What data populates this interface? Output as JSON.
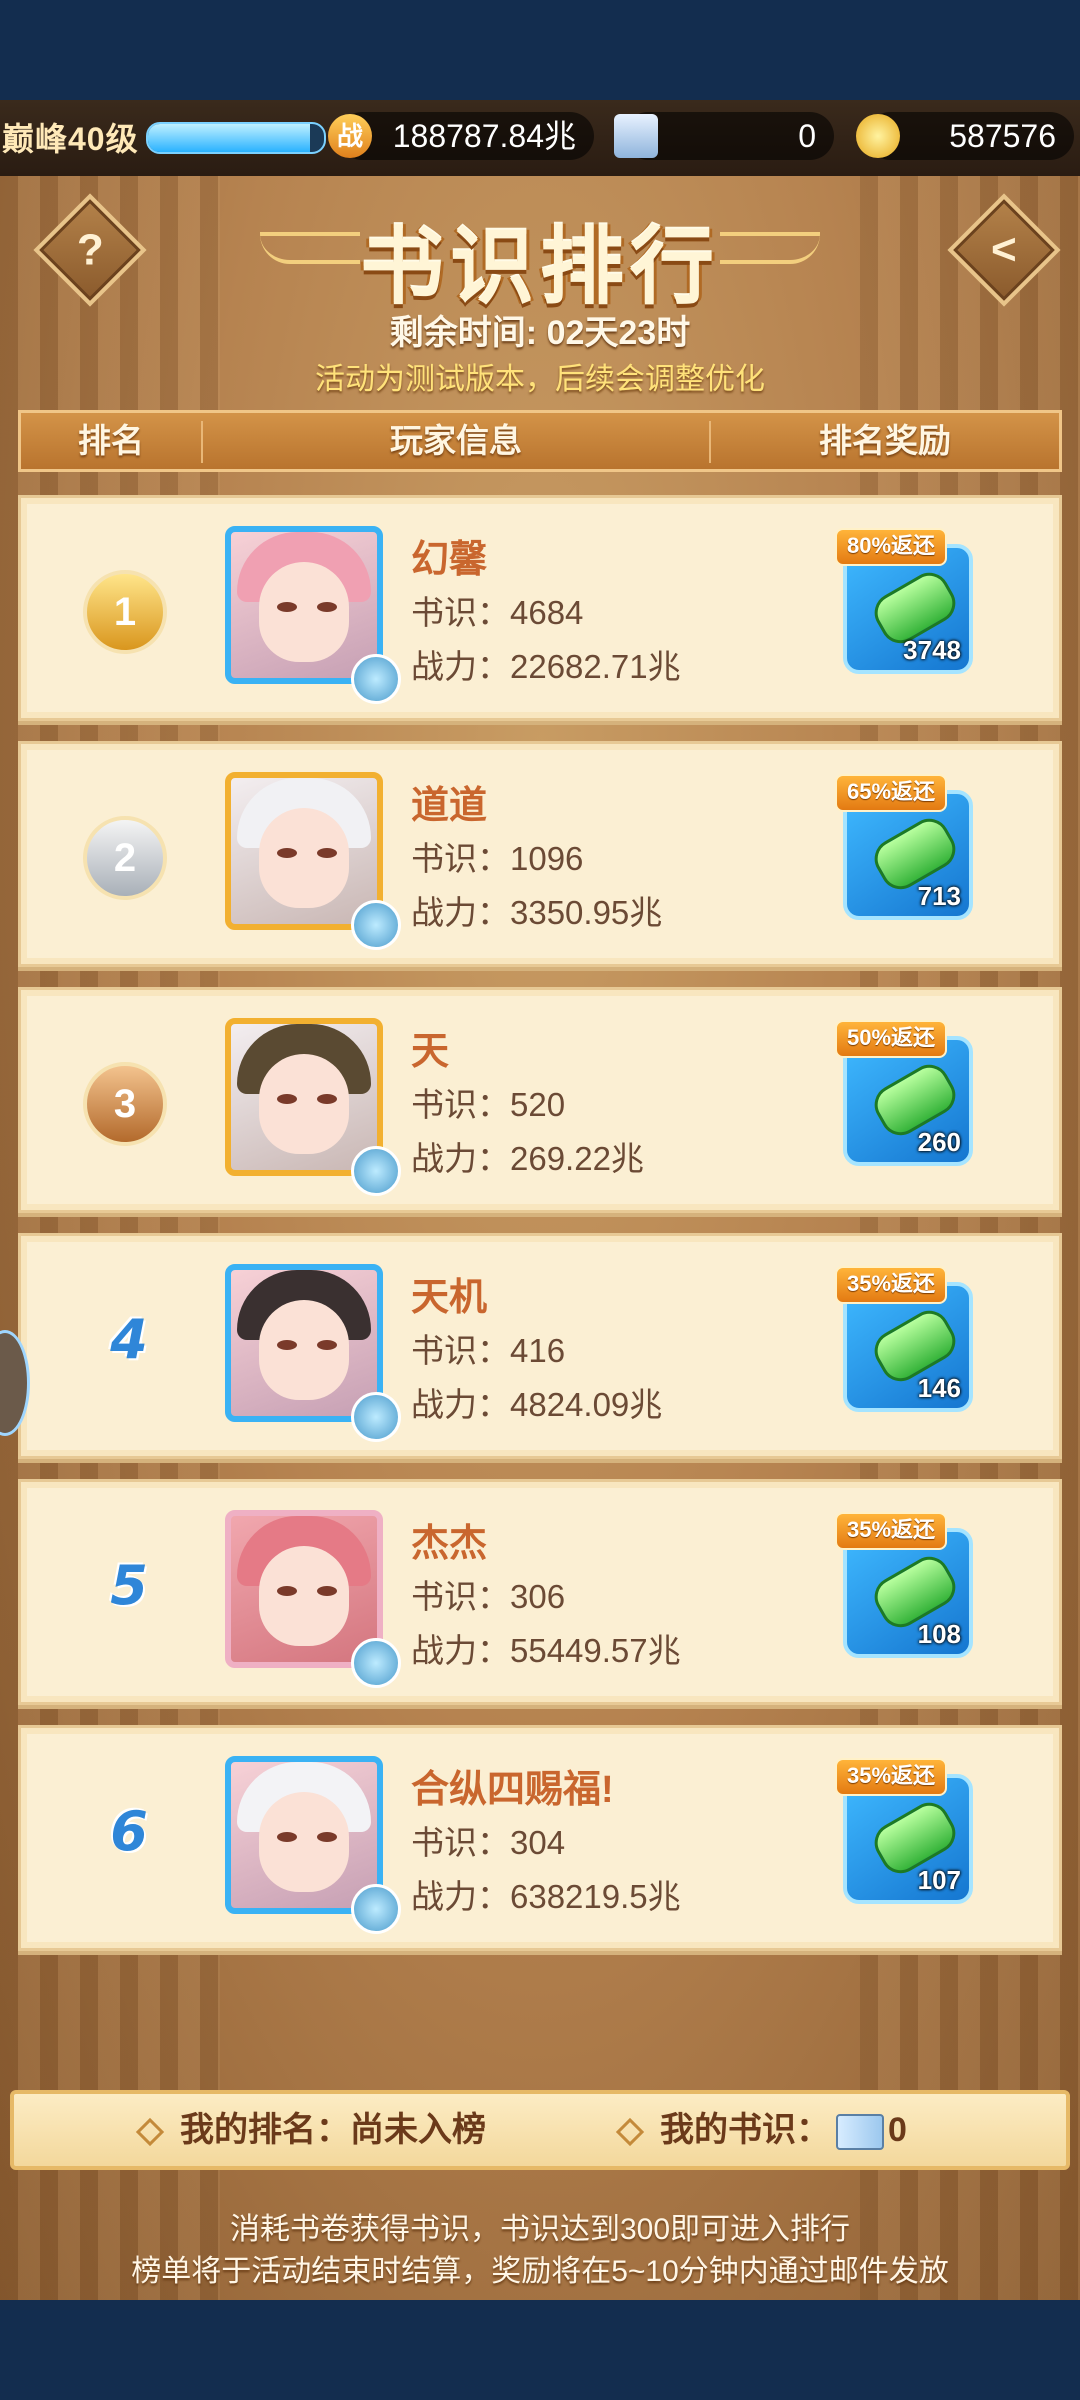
{
  "status_bar": {
    "level": "巅峰40级",
    "xp_progress": 0.92,
    "power_icon_text": "战",
    "power": "188787.84兆",
    "scroll_count": "0",
    "gold": "587576"
  },
  "header": {
    "help_label": "?",
    "back_label": "<",
    "title": "书识排行",
    "remaining_time": "剩余时间: 02天23时",
    "notice": "活动为测试版本，后续会调整优化"
  },
  "columns": {
    "rank": "排名",
    "player_info": "玩家信息",
    "reward": "排名奖励"
  },
  "rows": [
    {
      "rank": "1",
      "name": "幻馨",
      "shuzhi": "书识：4684",
      "power": "战力：22682.71兆",
      "return_badge": "80%返还",
      "reward_count": "3748",
      "frame": "blue",
      "color": "#f0a0b2"
    },
    {
      "rank": "2",
      "name": "道道",
      "shuzhi": "书识：1096",
      "power": "战力：3350.95兆",
      "return_badge": "65%返还",
      "reward_count": "713",
      "frame": "gold",
      "color": "#f1f1f4"
    },
    {
      "rank": "3",
      "name": "天",
      "shuzhi": "书识：520",
      "power": "战力：269.22兆",
      "return_badge": "50%返还",
      "reward_count": "260",
      "frame": "gold",
      "color": "#5a4a32"
    },
    {
      "rank": "4",
      "name": "天机",
      "shuzhi": "书识：416",
      "power": "战力：4824.09兆",
      "return_badge": "35%返还",
      "reward_count": "146",
      "frame": "blue",
      "color": "#3a3030"
    },
    {
      "rank": "5",
      "name": "杰杰",
      "shuzhi": "书识：306",
      "power": "战力：55449.57兆",
      "return_badge": "35%返还",
      "reward_count": "108",
      "frame": "pink",
      "color": "#e57a86"
    },
    {
      "rank": "6",
      "name": "合纵四赐福!",
      "shuzhi": "书识：304",
      "power": "战力：638219.5兆",
      "return_badge": "35%返还",
      "reward_count": "107",
      "frame": "blue",
      "color": "#f3f3f6"
    }
  ],
  "footer": {
    "my_rank": "我的排名：尚未入榜",
    "my_shuzhi_label": "我的书识：",
    "my_shuzhi_value": "0",
    "note_line1": "消耗书卷获得书识，书识达到300即可进入排行",
    "note_line2": "榜单将于活动结束时结算，奖励将在5~10分钟内通过邮件发放"
  }
}
